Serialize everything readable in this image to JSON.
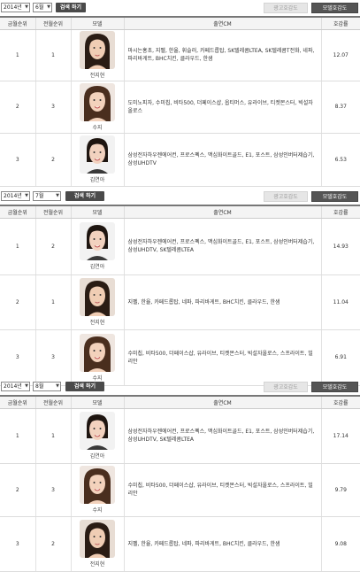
{
  "sections": [
    {
      "year": "2014년",
      "month": "6월",
      "search_label": "검색 하기",
      "tabs": [
        "광고호감도",
        "모델호감도"
      ],
      "headers": [
        "금월순위",
        "전월순위",
        "모델",
        "출연CM",
        "호감률"
      ],
      "rows": [
        {
          "cur": "1",
          "prev": "1",
          "name": "전지현",
          "cm": "마시는홍초, 지펠, 한율, 휘슬러, 카페드롭탑, SK텔레콤LTEA, SK텔레콤T전화, 네파, 파리바게트, BHC치킨, 클라우드, 한샘",
          "rate": "12.07"
        },
        {
          "cur": "2",
          "prev": "3",
          "name": "수지",
          "cm": "도미노피자, 수미칩, 비타500, 더페이스샵, 옵티머스, 유라이브, 티켓몬스터, 빅설자올로스",
          "rate": "8.37"
        },
        {
          "cur": "3",
          "prev": "2",
          "name": "김연아",
          "cm": "삼성전자하우젠에어컨, 프로스펙스, 맥심화이트골드, E1, 포스트, 삼성인버터제습기, 삼성UHDTV",
          "rate": "6.53"
        }
      ]
    },
    {
      "year": "2014년",
      "month": "7월",
      "search_label": "검색 하기",
      "tabs": [
        "광고호감도",
        "모델호감도"
      ],
      "headers": [
        "금월순위",
        "전월순위",
        "모델",
        "출연CM",
        "호감률"
      ],
      "rows": [
        {
          "cur": "1",
          "prev": "2",
          "name": "김연아",
          "cm": "삼성전자하우젠에어컨, 프로스펙스, 맥심화이트골드, E1, 포스트, 삼성인버터제습기, 삼성UHDTV, SK텔레콤LTEA",
          "rate": "14.93"
        },
        {
          "cur": "2",
          "prev": "1",
          "name": "전지현",
          "cm": "지펠, 한율, 카페드롭탑, 네파, 파리바게트, BHC치킨, 클라우드, 한샘",
          "rate": "11.04"
        },
        {
          "cur": "3",
          "prev": "3",
          "name": "수지",
          "cm": "수미칩, 비타500, 더페이스샵, 유라이브, 티켓몬스터, 빅설자올로스, 스프라이트, 빌리안",
          "rate": "6.91"
        }
      ]
    },
    {
      "year": "2014년",
      "month": "8월",
      "search_label": "검색 하기",
      "tabs": [
        "광고호감도",
        "모델호감도"
      ],
      "headers": [
        "금월순위",
        "전월순위",
        "모델",
        "출연CM",
        "호감률"
      ],
      "rows": [
        {
          "cur": "1",
          "prev": "1",
          "name": "김연아",
          "cm": "삼성전자하우젠에어컨, 프로스펙스, 맥심화이트골드, E1, 포스트, 삼성인버터제습기, 삼성UHDTV, SK텔레콤LTEA",
          "rate": "17.14"
        },
        {
          "cur": "2",
          "prev": "3",
          "name": "수지",
          "cm": "수미칩, 비타500, 더페이스샵, 유라이브, 티켓몬스터, 빅설자올로스, 스프라이트, 빌리안",
          "rate": "9.79"
        },
        {
          "cur": "3",
          "prev": "2",
          "name": "전지현",
          "cm": "지펠, 한율, 카페드롭탑, 네파, 파리바게트, BHC치킨, 클라우드, 한샘",
          "rate": "9.08"
        }
      ]
    }
  ],
  "colors": {
    "header_bg": "#f4f4f4",
    "search_button": "#4a4a4a",
    "active_tab": "#555555",
    "inactive_tab": "#e6e6e6"
  },
  "icons": {
    "dropdown": "dropdown-arrow-icon",
    "portrait": "model-portrait-photo"
  }
}
